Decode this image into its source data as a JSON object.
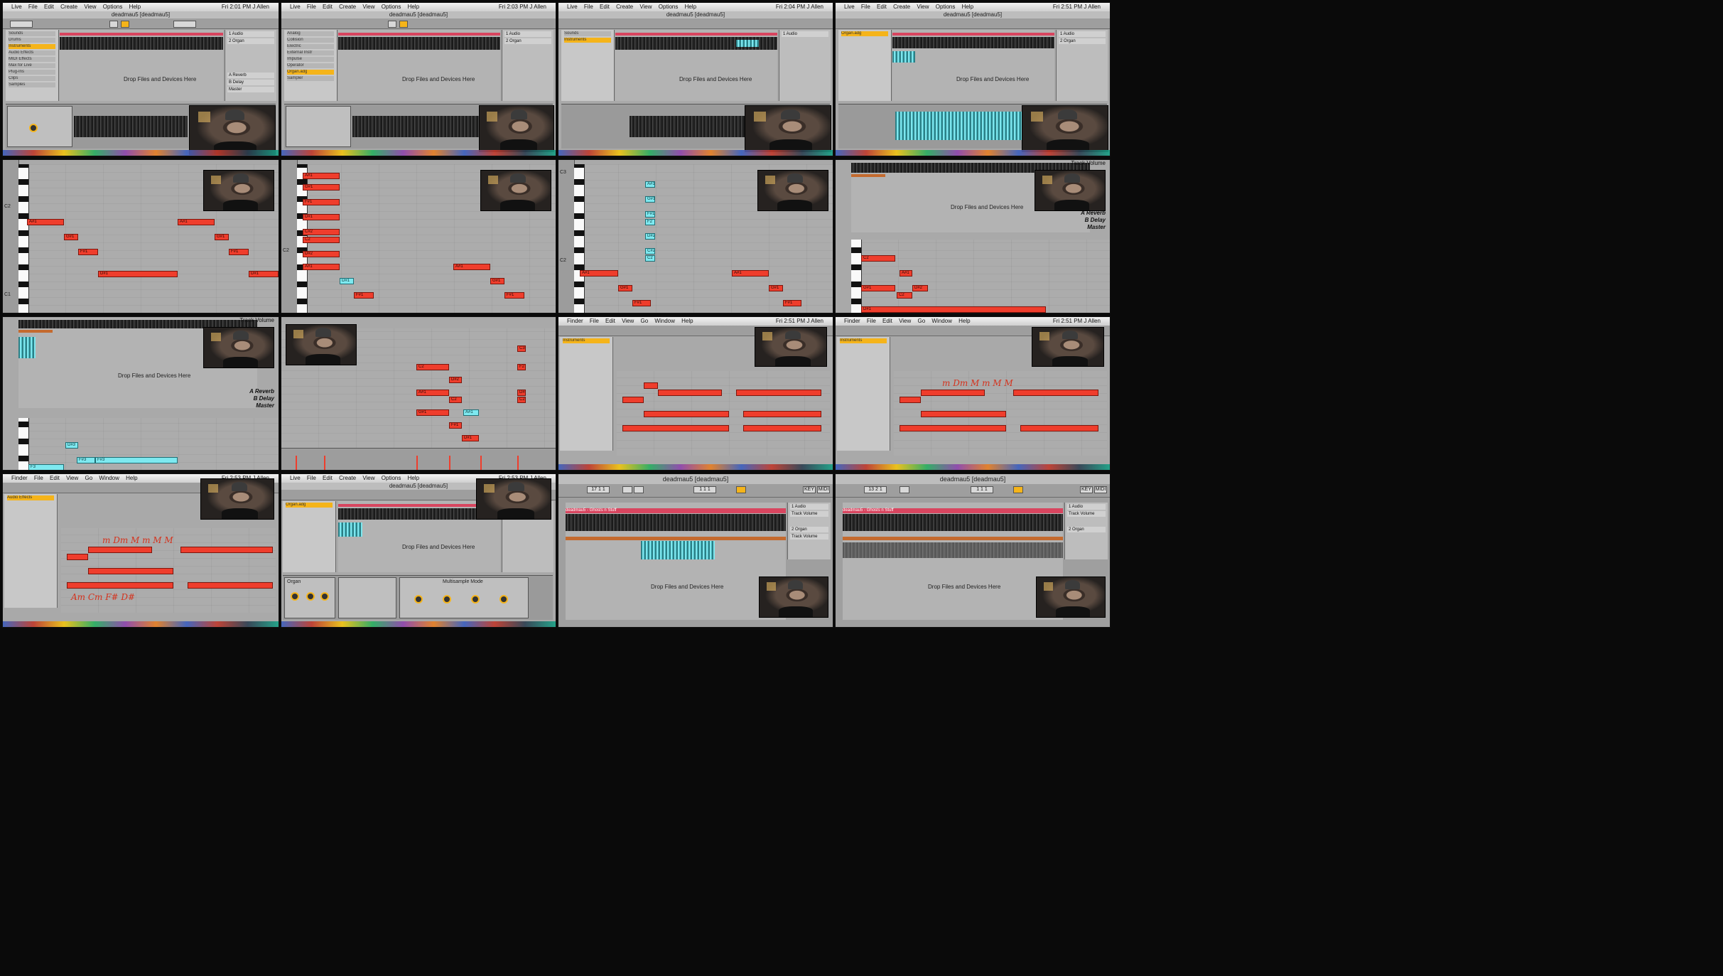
{
  "menus": {
    "live": [
      "Live",
      "File",
      "Edit",
      "Create",
      "View",
      "Options",
      "Help"
    ],
    "finder": [
      "Finder",
      "File",
      "Edit",
      "View",
      "Go",
      "Window",
      "Help"
    ]
  },
  "clock": {
    "t1": "Fri 2:01 PM  J Allen",
    "t2": "Fri 2:03 PM  J Allen",
    "t3": "Fri 2:04 PM  J Allen",
    "t4": "Fri 2:51 PM  J Allen",
    "t5": "Fri 2:53 PM  J Allen"
  },
  "window_title": "deadmau5  [deadmau5]",
  "clip_name": "deadmau5 - Ghosts n Stuff",
  "drop_text": "Drop Files and Devices Here",
  "tracks": {
    "audio": "1 Audio",
    "organ": "2 Organ",
    "reverb": "A Reverb",
    "delay": "B Delay",
    "master": "Master",
    "track_volume": "Track Volume"
  },
  "browser_items": [
    "Sounds",
    "Drums",
    "Instruments",
    "Audio Effects",
    "MIDI Effects",
    "Max for Live",
    "Plug-Ins",
    "Clips",
    "Samples"
  ],
  "browser_files": [
    "Analog",
    "Collision",
    "Electric",
    "External Instr",
    "Impulse",
    "Operator",
    "Organ.adg",
    "Sampler",
    "Simpler",
    "Tension"
  ],
  "notes": {
    "ab1": "A#1",
    "gs1": "G#1",
    "fs1": "F#1",
    "ds1": "D#1",
    "c1": "C1",
    "cs2": "C#2",
    "ds2": "D#2",
    "f2": "F2",
    "g2": "G2",
    "c2": "C2",
    "c3": "C3",
    "fs3": "F#3",
    "ds3": "D#3",
    "f3": "F3"
  },
  "octaves": {
    "c1": "C1",
    "c2": "C2",
    "c3": "C3"
  },
  "scribbles": {
    "s1": "m Dm M m M M",
    "s2": "m Dm M m M M",
    "s3": "m Dm M m M M",
    "s4": "Am  Cm  F#  D#"
  },
  "device": {
    "title": "Organ",
    "mode": "Multisample Mode"
  },
  "transport": {
    "bar": "17   1   1",
    "position": "1   1   1",
    "pos2": "13   2   1",
    "key": "KEY",
    "midi": "MIDI"
  },
  "scale_label": "1/1"
}
